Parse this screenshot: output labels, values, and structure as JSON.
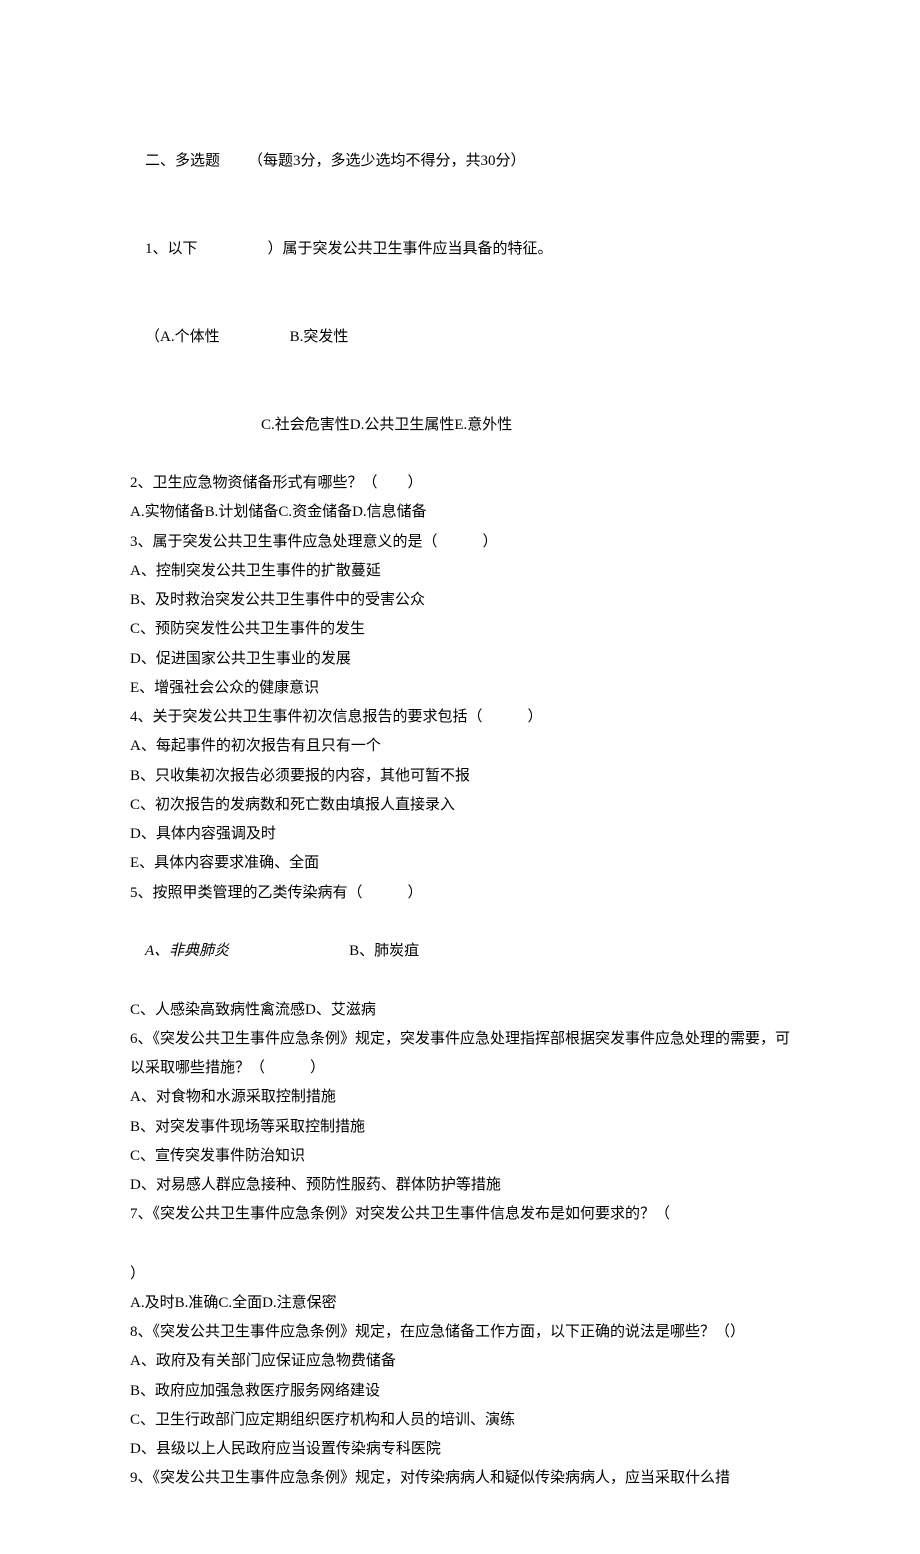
{
  "section": {
    "title_prefix": "二、多选题",
    "title_rule": "（每题3分，多选少选均不得分，共30分）"
  },
  "q1": {
    "stem_a": "1、以下",
    "stem_b": "）属于突发公共卫生事件应当具备的特征。",
    "line2_a": "（A.个体性",
    "line2_b": "B.突发性",
    "line3": "C.社会危害性D.公共卫生属性E.意外性"
  },
  "q2": {
    "stem": "2、卫生应急物资储备形式有哪些？（　　）",
    "options": "A.实物储备B.计划储备C.资金储备D.信息储备"
  },
  "q3": {
    "stem": "3、属于突发公共卫生事件应急处理意义的是（　　　）",
    "a": "A、控制突发公共卫生事件的扩散蔓延",
    "b": "B、及时救治突发公共卫生事件中的受害公众",
    "c": "C、预防突发性公共卫生事件的发生",
    "d": "D、促进国家公共卫生事业的发展",
    "e": "E、增强社会公众的健康意识"
  },
  "q4": {
    "stem": "4、关于突发公共卫生事件初次信息报告的要求包括（　　　）",
    "a": "A、每起事件的初次报告有且只有一个",
    "b": "B、只收集初次报告必须要报的内容，其他可暂不报",
    "c": "C、初次报告的发病数和死亡数由填报人直接录入",
    "d": "D、具体内容强调及时",
    "e": "E、具体内容要求准确、全面"
  },
  "q5": {
    "stem": "5、按照甲类管理的乙类传染病有（　　　）",
    "line_ab_a": "A、非典肺炎",
    "line_ab_b": "B、肺炭疽",
    "line_cd": "C、人感染高致病性禽流感D、艾滋病"
  },
  "q6": {
    "stem": "6、《突发公共卫生事件应急条例》规定，突发事件应急处理指挥部根据突发事件应急处理的需要，可以采取哪些措施？（　　　）",
    "a": "A、对食物和水源采取控制措施",
    "b": "B、对突发事件现场等采取控制措施",
    "c": "C、宣传突发事件防治知识",
    "d": "D、对易感人群应急接种、预防性服药、群体防护等措施"
  },
  "q7": {
    "stem": "7、《突发公共卫生事件应急条例》对突发公共卫生事件信息发布是如何要求的？（",
    "close": "）",
    "options": "A.及时B.准确C.全面D.注意保密"
  },
  "q8": {
    "stem": "8、《突发公共卫生事件应急条例》规定，在应急储备工作方面，以下正确的说法是哪些？（）",
    "a": "A、政府及有关部门应保证应急物费储备",
    "b": "B、政府应加强急救医疗服务网络建设",
    "c": "C、卫生行政部门应定期组织医疗机构和人员的培训、演练",
    "d": "D、县级以上人民政府应当设置传染病专科医院"
  },
  "q9": {
    "stem": "9、《突发公共卫生事件应急条例》规定，对传染病病人和疑似传染病病人，应当采取什么措"
  }
}
